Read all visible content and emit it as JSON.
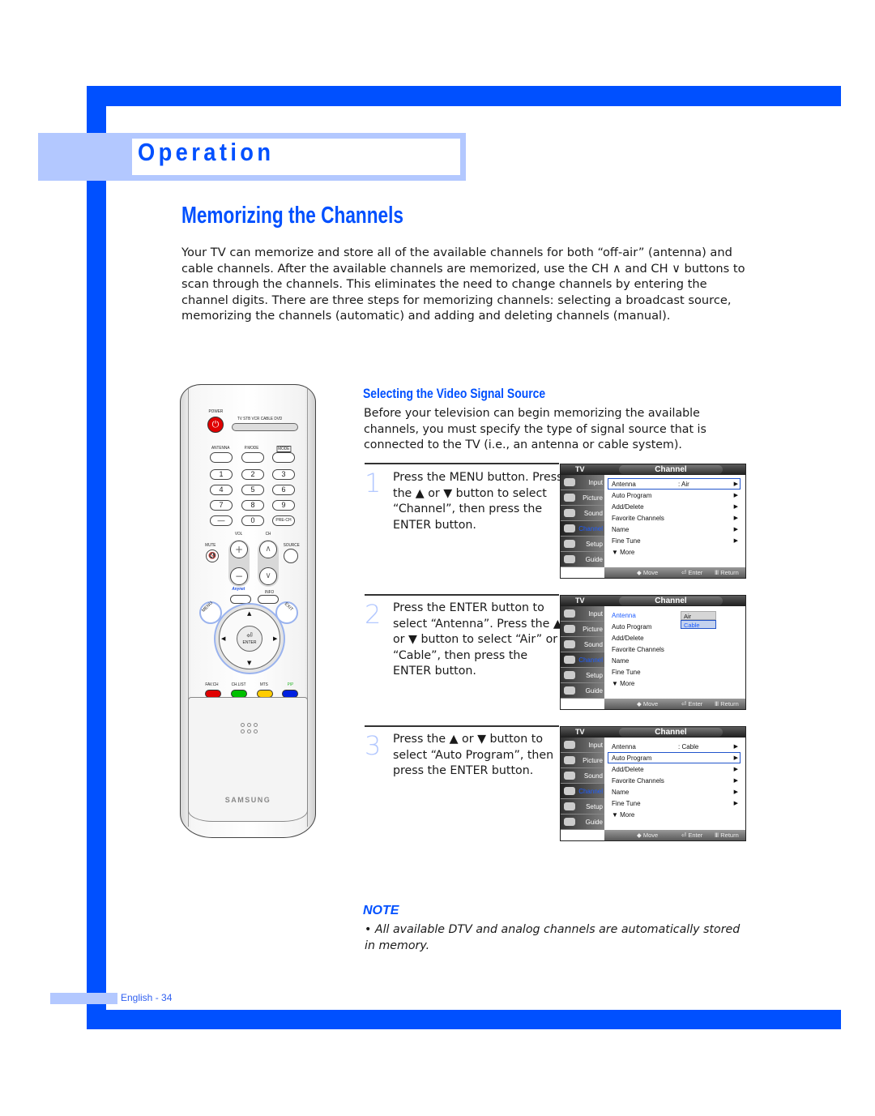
{
  "section": {
    "title": "Operation"
  },
  "page": {
    "title": "Memorizing the Channels",
    "intro": "Your TV can memorize and store all of the available channels for both “off-air” (antenna) and cable channels. After the available channels are memorized, use the CH ∧ and CH ∨ buttons to scan through the channels. This eliminates the need to change channels by entering the channel digits. There are three steps for memorizing channels: selecting a broadcast source, memorizing the channels (automatic) and adding and deleting channels (manual)."
  },
  "remote": {
    "power_label": "POWER",
    "mode_labels": "TV  STB  VCR  CABLE  DVD",
    "top_labels": [
      "ANTENNA",
      "P.MODE",
      "MODE"
    ],
    "number_keys": [
      "1",
      "2",
      "3",
      "4",
      "5",
      "6",
      "7",
      "8",
      "9",
      "—",
      "0",
      "PRE-CH"
    ],
    "vol_label": "VOL",
    "ch_label": "CH",
    "mute_label": "MUTE",
    "source_label": "SOURCE",
    "anynet_label": "Anynet",
    "info_label": "INFO",
    "menu_label": "MENU",
    "exit_label": "EXIT",
    "enter_label": "ENTER",
    "color_labels": [
      "FAV.CH",
      "CH.LIST",
      "MTS",
      "PIP"
    ],
    "color_values": [
      "#e00000",
      "#00c000",
      "#ffcc00",
      "#0020e0"
    ],
    "brand": "SAMSUNG"
  },
  "subsection": {
    "title": "Selecting the Video Signal Source",
    "intro": "Before your television can begin memorizing the available channels, you must specify the type of signal source that is connected to the TV (i.e., an antenna or cable system)."
  },
  "steps": [
    {
      "number": "1",
      "text": "Press the MENU button. Press the ▲ or ▼ button to select “Channel”, then press the ENTER button."
    },
    {
      "number": "2",
      "text": "Press the ENTER button to select “Antenna”. Press the ▲ or ▼ button to select “Air” or “Cable”, then press the ENTER button."
    },
    {
      "number": "3",
      "text": "Press the ▲ or ▼ button to select “Auto Program”, then press the ENTER button."
    }
  ],
  "osd": {
    "tv_label": "TV",
    "title": "Channel",
    "tabs": [
      "Input",
      "Picture",
      "Sound",
      "Channel",
      "Setup",
      "Guide"
    ],
    "items": [
      "Antenna",
      "Auto Program",
      "Add/Delete",
      "Favorite Channels",
      "Name",
      "Fine Tune",
      "▼ More"
    ],
    "footer": {
      "move": "◆ Move",
      "enter": "⏎ Enter",
      "return": "Ⅲ Return"
    },
    "screens": [
      {
        "antenna_value": ": Air",
        "selected": "Antenna"
      },
      {
        "antenna_value": "",
        "selected": "Antenna",
        "popup": [
          "Air",
          "Cable"
        ],
        "popup_selected": "Cable"
      },
      {
        "antenna_value": ": Cable",
        "selected": "Auto Program"
      }
    ]
  },
  "note": {
    "title": "NOTE",
    "text": "• All available DTV and analog channels are automatically stored in memory."
  },
  "footer": {
    "page_label": "English - 34"
  }
}
